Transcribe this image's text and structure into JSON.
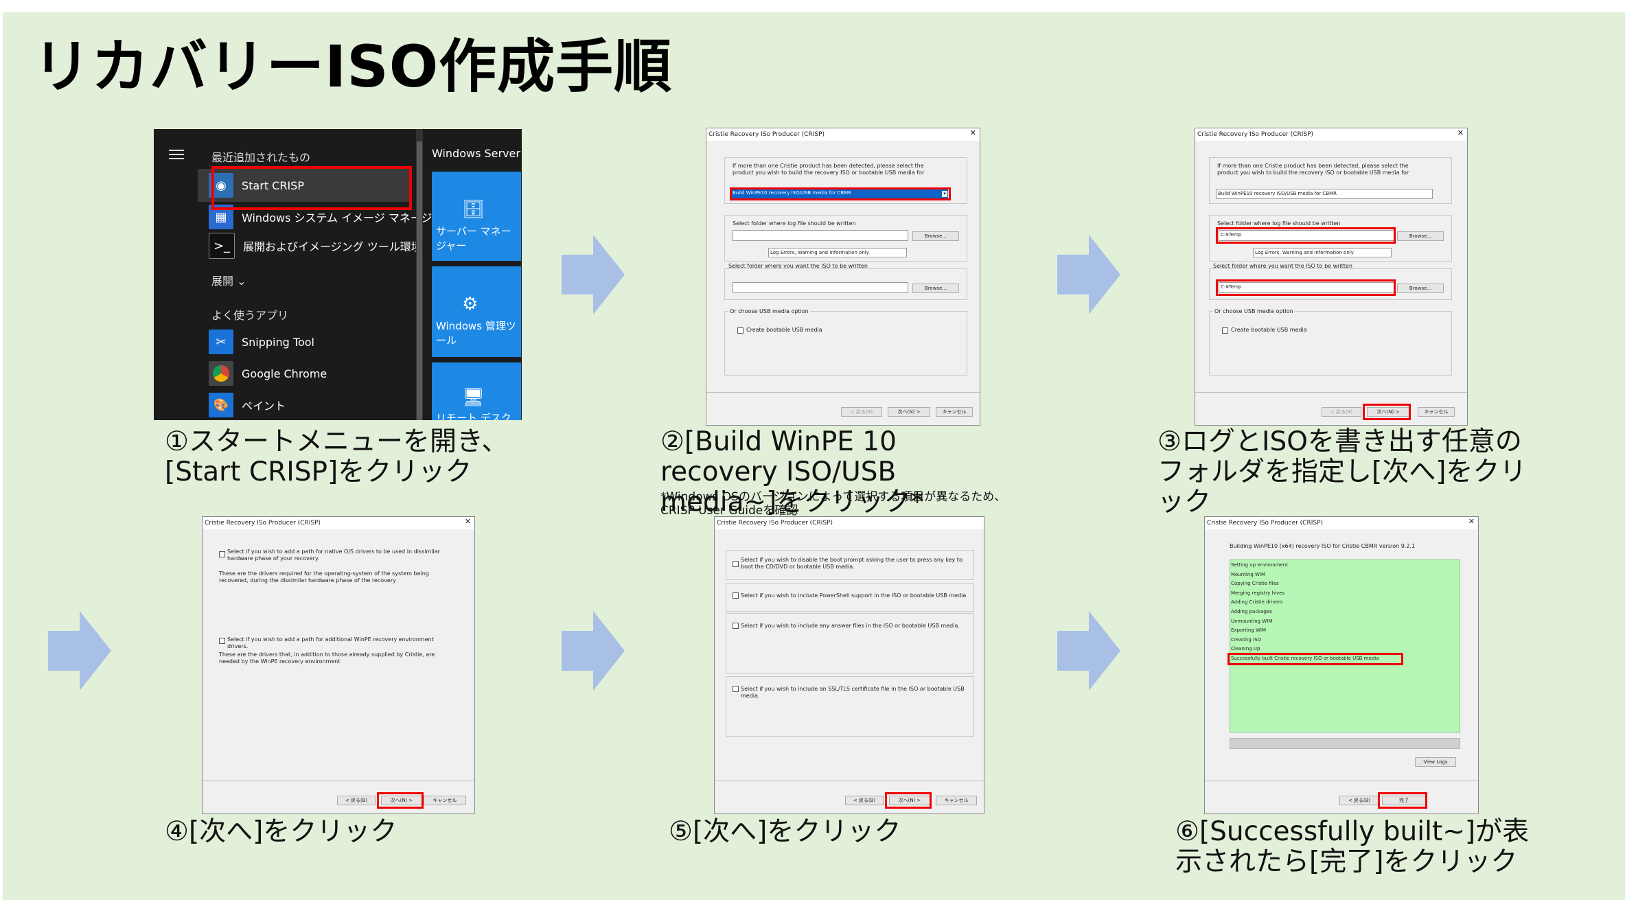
{
  "title": "リカバリーISO作成手順",
  "colors": {
    "background": "#e2efd9",
    "arrow": "#a8c0e6",
    "highlight": "#e00000",
    "success_panel": "#b6f7b6"
  },
  "captions": {
    "step1": "①スタートメニューを開き、[Start CRISP]をクリック",
    "step2": "②[Build WinPE 10 recovery ISO/USB media~]をクリック*",
    "step2_note": "*Windows OSのバージョンによって選択する項目が異なるため、CRISP User Guideを確認",
    "step3": "③ログとISOを書き出す任意のフォルダを指定し[次へ]をクリック",
    "step4": "④[次へ]をクリック",
    "step5": "⑤[次へ]をクリック",
    "step6": "⑥[Successfully built~]が表示されたら[完了]をクリック"
  },
  "start_menu": {
    "recent_header": "最近追加されたもの",
    "items": [
      "Start CRISP",
      "Windows システム イメージ マネージャー",
      "展開およびイメージング ツール環境"
    ],
    "expand": "展開",
    "frequent_header": "よく使うアプリ",
    "apps": [
      "Snipping Tool",
      "Google Chrome",
      "ペイント"
    ],
    "group": "Windows Server",
    "tiles": [
      "サーバー マネージャー",
      "Windows 管理ツール",
      "リモート デスクトップ"
    ]
  },
  "dialog": {
    "title": "Cristie Recovery ISo Producer (CRISP)",
    "select_prompt": "If more than one Cristie product has been detected, please select the product you wish to build the recovery ISO or bootable USB media for",
    "selected_product": "Build WinPE10 recovery ISO/USB media for CBMR",
    "log_folder_label": "Select folder where log file should be written",
    "iso_folder_label": "Select folder where you want the ISO to be written",
    "browse": "Browse...",
    "log_level": "Log Errors, Warning and Information only",
    "usb_group": "Or choose USB media option",
    "usb_check": "Create bootable USB media",
    "folder_value": "C:¥Temp",
    "back": "< 戻る(B)",
    "next": "次へ(N) >",
    "cancel": "キャンセル",
    "finish": "完了"
  },
  "step4_dialog": {
    "driver1": "Select if you wish to add a path for native O/S drivers to be used in dissimilar hardware phase of your recovery.",
    "driver1_desc": "These are the drivers required for the operating-system of the system being recovered, during the dissimilar hardware phase of the recovery",
    "driver2": "Select if you wish to add a path for additional WinPE recovery environment drivers.",
    "driver2_desc": "These are the drivers that, in addition to those already supplied by Cristie, are needed by the WinPE recovery environment"
  },
  "step5_dialog": {
    "opt1": "Select if you wish to disable the boot prompt asking the user to press any key to boot the CD/DVD or bootable USB media.",
    "opt2": "Select if you wish to include PowerShell support in the ISO or bootable USB media",
    "opt3": "Select if you wish to include any answer files in the ISO or bootable USB media.",
    "opt4": "Select if you wish to include an SSL/TLS certificate file in the ISO or bootable USB media."
  },
  "step6_dialog": {
    "building": "Building WinPE10 (x64) recovery ISO for Cristie CBMR version 9.2.1",
    "log": [
      "Setting up environment",
      "Mounting WIM",
      "Copying Cristie files",
      "Merging registry hives",
      "Adding Cristie drivers",
      "Adding packages",
      "Unmounting WIM",
      "Exporting WIM",
      "Creating ISO",
      "Cleaning Up",
      "Successfully built Cristie recovery ISO or bootable USB media"
    ],
    "view_logs": "View Logs"
  }
}
